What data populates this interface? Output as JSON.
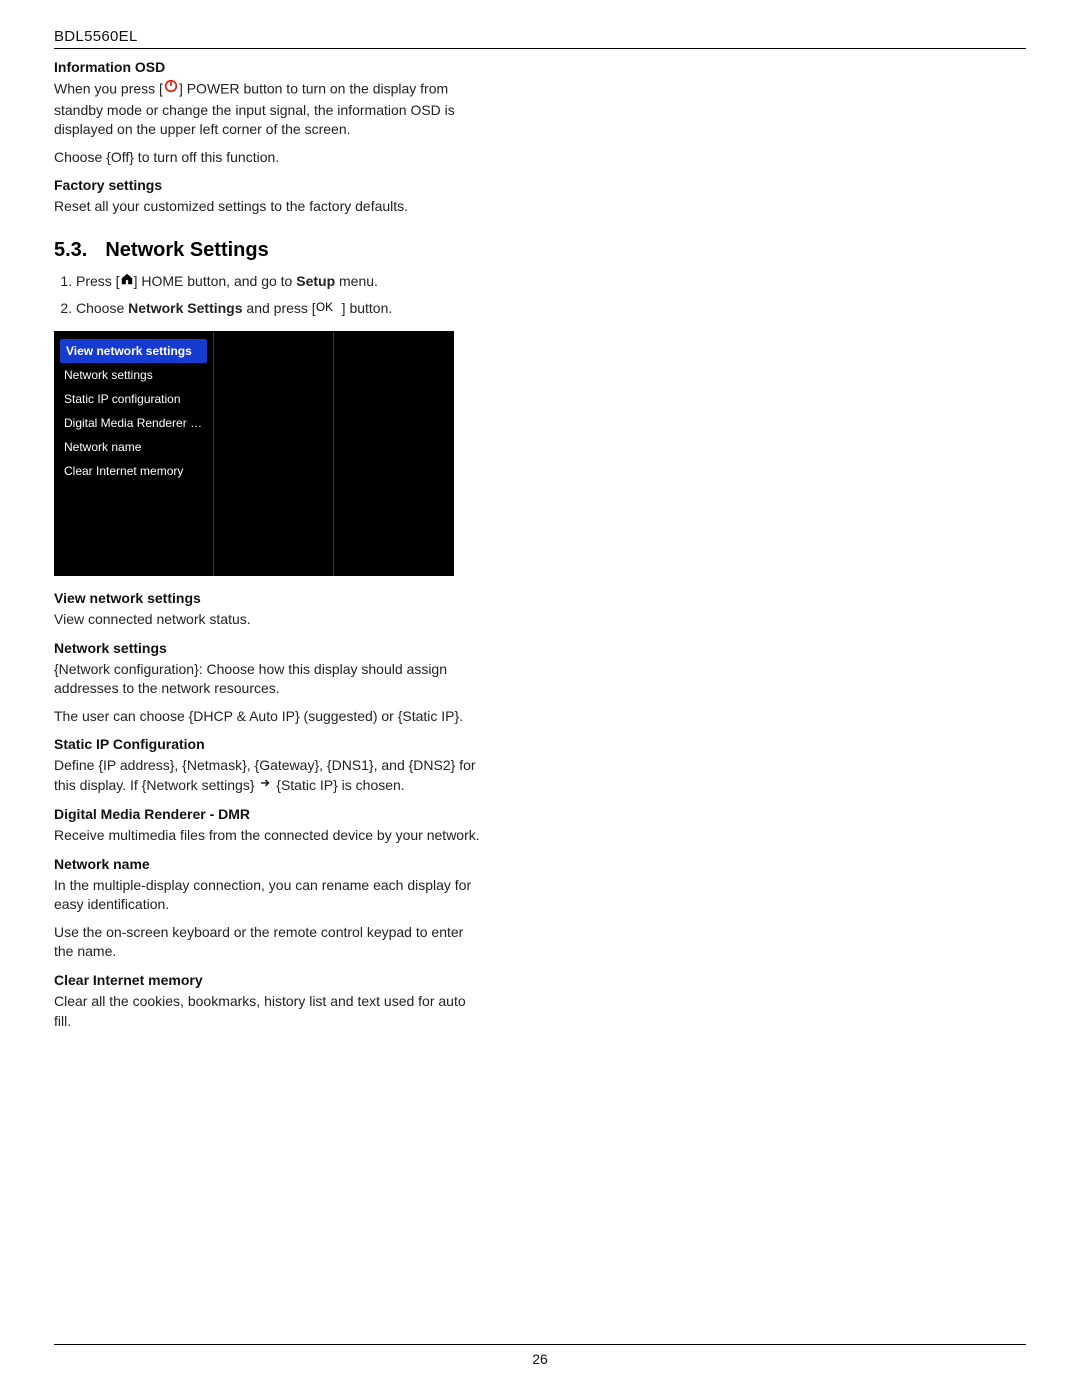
{
  "header": {
    "model": "BDL5560EL"
  },
  "page_number": "26",
  "info_osd": {
    "title": "Information OSD",
    "para1_a": "When you press [",
    "para1_b": "] POWER button to turn on the display from standby mode or change the input signal, the information OSD is displayed on the upper left corner of the screen.",
    "para2": "Choose {Off} to turn off this function."
  },
  "factory": {
    "title": "Factory settings",
    "para": "Reset all your customized settings to the factory defaults."
  },
  "section": {
    "num": "5.3.",
    "title": "Network Settings",
    "step1_a": "Press [",
    "step1_b": "] HOME button, and go to ",
    "step1_setup": "Setup",
    "step1_c": " menu.",
    "step2_a": "Choose ",
    "step2_ns": "Network Settings",
    "step2_b": " and press [",
    "step2_c": "] button."
  },
  "osd_menu": {
    "items": [
      "View network settings",
      "Network settings",
      "Static IP configuration",
      "Digital Media Renderer - D...",
      "Network name",
      "Clear Internet memory"
    ]
  },
  "view_net": {
    "title": "View network settings",
    "para": "View connected network status."
  },
  "net_settings": {
    "title": "Network settings",
    "para1": "{Network configuration}: Choose how this display should assign addresses to the network resources.",
    "para2": "The user can choose {DHCP & Auto IP} (suggested) or {Static IP}."
  },
  "static_ip": {
    "title": "Static IP Configuration",
    "para_a": "Define {IP address}, {Netmask}, {Gateway}, {DNS1}, and {DNS2} for this display. If {Network settings} ",
    "para_b": " {Static IP} is chosen."
  },
  "dmr": {
    "title": "Digital Media Renderer - DMR",
    "para": "Receive multimedia files from the connected device by your network."
  },
  "net_name": {
    "title": "Network name",
    "para1": "In the multiple-display connection, you can rename each display for easy identification.",
    "para2": "Use the on-screen keyboard or the remote control keypad to enter the name."
  },
  "clear_mem": {
    "title": "Clear Internet memory",
    "para": "Clear all the cookies, bookmarks, history list and text used for auto fill."
  }
}
